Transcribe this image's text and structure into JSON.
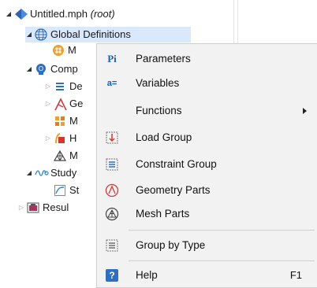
{
  "tree": {
    "root_label": "Untitled.mph",
    "root_suffix": "(root)",
    "global_definitions": "Global Definitions",
    "gd_child_partial": "M",
    "component_partial": "Comp",
    "comp_children_partial": [
      "De",
      "Ge",
      "M",
      "H",
      "M"
    ],
    "study_partial": "Study",
    "study_child_partial": "St",
    "results_partial": "Resul"
  },
  "context_menu": {
    "items": [
      {
        "label": "Parameters",
        "icon": "parameters-icon"
      },
      {
        "label": "Variables",
        "icon": "variables-icon"
      },
      {
        "label": "Functions",
        "icon": "none",
        "submenu": true
      },
      {
        "label": "Load Group",
        "icon": "load-group-icon"
      },
      {
        "label": "Constraint Group",
        "icon": "constraint-group-icon"
      },
      {
        "label": "Geometry Parts",
        "icon": "geometry-parts-icon"
      },
      {
        "label": "Mesh Parts",
        "icon": "mesh-parts-icon"
      },
      {
        "label": "Group by Type",
        "icon": "group-by-type-icon"
      },
      {
        "label": "Help",
        "icon": "help-icon",
        "shortcut": "F1"
      }
    ],
    "parameters_glyph": "Pi",
    "variables_glyph": "a=",
    "help_glyph": "?"
  },
  "colors": {
    "selection": "#d9e8fb",
    "menu_background": "#f2f2f2",
    "accent_blue": "#1d5fb3"
  }
}
